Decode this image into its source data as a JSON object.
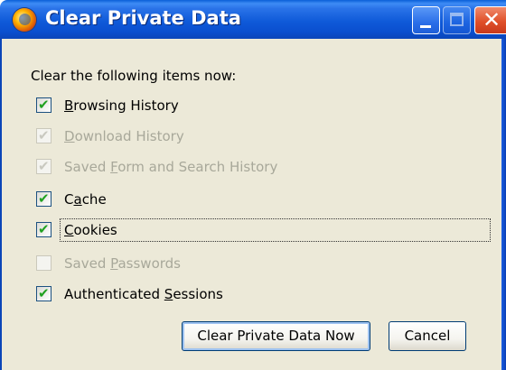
{
  "window": {
    "title": "Clear Private Data"
  },
  "dialog": {
    "intro": "Clear the following items now:",
    "items": [
      {
        "pre": "",
        "key": "B",
        "post": "rowsing History",
        "checked": true,
        "enabled": true
      },
      {
        "pre": "",
        "key": "D",
        "post": "ownload History",
        "checked": true,
        "enabled": false
      },
      {
        "pre": "Saved ",
        "key": "F",
        "post": "orm and Search History",
        "checked": true,
        "enabled": false
      },
      {
        "pre": "C",
        "key": "a",
        "post": "che",
        "checked": true,
        "enabled": true
      },
      {
        "pre": "",
        "key": "C",
        "post": "ookies",
        "checked": true,
        "enabled": true
      },
      {
        "pre": "Saved ",
        "key": "P",
        "post": "asswords",
        "checked": false,
        "enabled": false
      },
      {
        "pre": "Authenticated ",
        "key": "S",
        "post": "essions",
        "checked": true,
        "enabled": true
      }
    ],
    "tick": "✔"
  },
  "buttons": {
    "clear_now": "Clear Private Data Now",
    "cancel": "Cancel"
  },
  "titlebar": {
    "close_glyph": "✕"
  }
}
